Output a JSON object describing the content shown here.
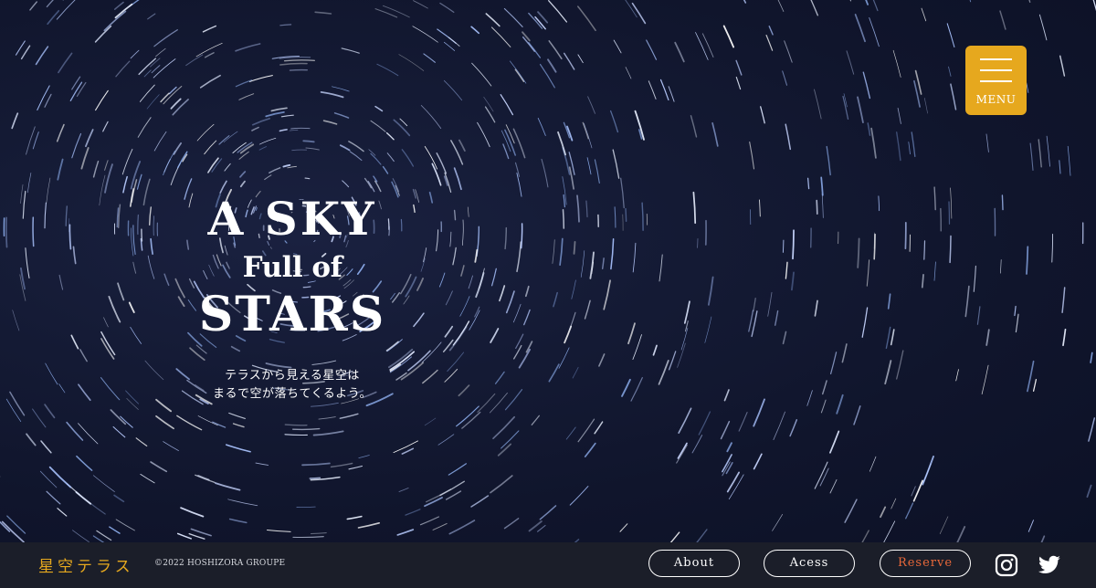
{
  "hero": {
    "headline_line1": "A SKY",
    "headline_line2": "Full of",
    "headline_line3": "STARS",
    "subcopy_line1": "テラスから見える星空は",
    "subcopy_line2": "まるで空が落ちてくるよう。",
    "background": "star-trail-night-sky"
  },
  "menu": {
    "label": "MENU",
    "icon": "hamburger-icon",
    "color": "#e6a81e"
  },
  "footer": {
    "logo": "星空テラス",
    "copyright": "©2022 HOSHIZORA GROUPE",
    "nav": [
      {
        "label": "About"
      },
      {
        "label": "Acess"
      },
      {
        "label": "Reserve"
      }
    ],
    "social": [
      {
        "icon": "instagram-icon"
      },
      {
        "icon": "twitter-icon"
      }
    ]
  },
  "colors": {
    "accent": "#e6a81e",
    "reserve": "#e8683a",
    "footer_bg": "#1b1e29",
    "sky": "#141a34"
  }
}
